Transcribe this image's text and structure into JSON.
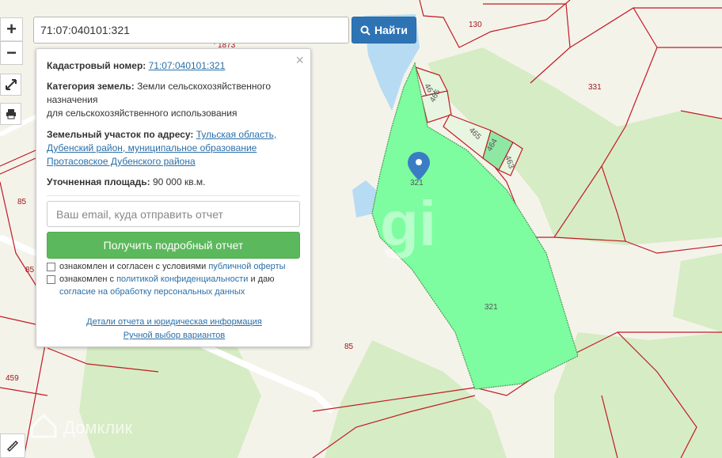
{
  "search": {
    "value": "71:07:040101:321",
    "button_label": "Найти"
  },
  "controls": {
    "zoom_in": "+",
    "zoom_out": "−"
  },
  "popup": {
    "close": "×",
    "cadastral_label": "Кадастровый номер:",
    "cadastral_value": "71:07:040101:321",
    "category_label": "Категория земель:",
    "category_value_1": "Земли сельскохозяйственного",
    "category_value_2": "назначения",
    "category_value_3": "для сельскохозяйственного использования",
    "address_label": "Земельный участок по адресу:",
    "address_1": "Тульская область,",
    "address_2": "Дубенский район, муниципальное образование",
    "address_3": "Протасовское Дубенского района",
    "area_label": "Уточненная площадь:",
    "area_value": "90 000 кв.м.",
    "email_placeholder": "Ваш email, куда отправить отчет",
    "report_button": "Получить подробный отчет",
    "check1_text": "ознакомлен и согласен с условиями",
    "check1_link": "публичной оферты",
    "check2_text_1": "ознакомлен с",
    "check2_link_1": "политикой конфиденциальности",
    "check2_text_2": "и даю",
    "check2_link_2": "согласие на обработку персональных данных",
    "details_link": "Детали отчета и юридическая информация",
    "manual_link": "Ручной выбор вариантов"
  },
  "map_labels": {
    "l130": "130",
    "l331": "331",
    "l467": "467",
    "l466": "466",
    "l465": "465",
    "l464": "464",
    "l463": "463",
    "l321_marker": "321",
    "l321_center": "321",
    "l85_left": "85",
    "l85_left2": "85",
    "l85_bottom": "85",
    "l459": "459",
    "l1873": "1873"
  },
  "watermarks": {
    "center": "gi",
    "bottom": "Домклик"
  },
  "colors": {
    "parcel_fill": "#7dfda0",
    "boundary": "#c21a24",
    "water": "#b7dbf3",
    "forest": "#d6ecc4",
    "marker": "#3b7dc4"
  }
}
